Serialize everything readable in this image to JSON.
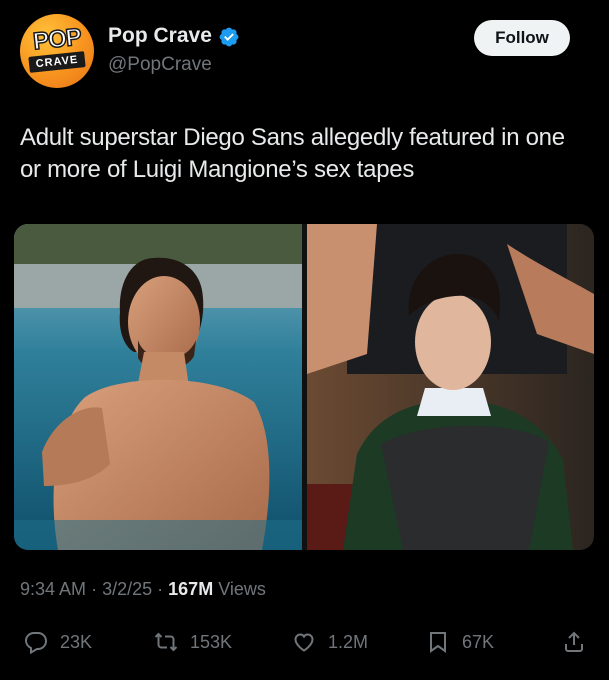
{
  "account": {
    "display_name": "Pop Crave",
    "handle": "@PopCrave",
    "verified": true,
    "avatar_logo_top": "POP",
    "avatar_logo_bottom": "CRAVE",
    "verified_color": "#1d9bf0"
  },
  "follow_button": {
    "label": "Follow"
  },
  "tweet": {
    "text": "Adult superstar Diego Sans allegedly featured in one or more of Luigi Mangione’s sex tapes"
  },
  "meta": {
    "time": "9:34 AM",
    "sep1": "·",
    "date": "3/2/25",
    "sep2": "·",
    "views_count": "167M",
    "views_label": "Views"
  },
  "actions": {
    "replies": "23K",
    "reposts": "153K",
    "likes": "1.2M",
    "bookmarks": "67K"
  },
  "icons": {
    "reply": "reply-icon",
    "repost": "repost-icon",
    "like": "heart-icon",
    "bookmark": "bookmark-icon",
    "share": "share-icon",
    "verified": "verified-badge-icon"
  }
}
